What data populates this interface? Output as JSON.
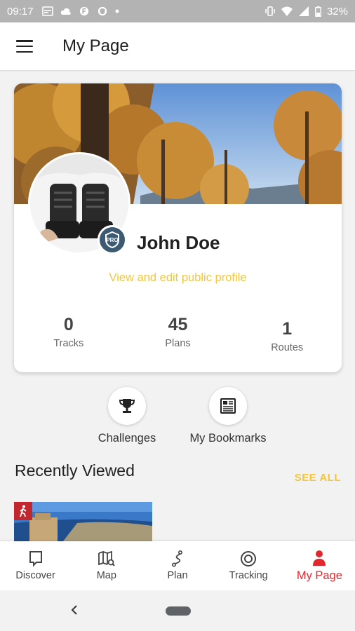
{
  "status_bar": {
    "time": "09:17",
    "battery": "32%",
    "icons": [
      "calendar-icon",
      "cloud-icon",
      "app-icon",
      "shield-icon",
      "dot-icon",
      "vibrate-icon",
      "wifi-icon",
      "signal-icon",
      "battery-icon"
    ]
  },
  "app_bar": {
    "title": "My Page",
    "menu_icon": "hamburger-icon"
  },
  "profile": {
    "name": "John Doe",
    "edit_link": "View and edit public profile",
    "badge": "PRO",
    "stats": [
      {
        "value": "0",
        "label": "Tracks"
      },
      {
        "value": "45",
        "label": "Plans"
      },
      {
        "value": "1",
        "label": "Routes"
      }
    ]
  },
  "shortcuts": [
    {
      "label": "Challenges",
      "icon": "trophy-icon"
    },
    {
      "label": "My Bookmarks",
      "icon": "bookmarks-icon"
    }
  ],
  "recently_viewed": {
    "title": "Recently Viewed",
    "see_all": "SEE ALL",
    "item_icon": "hiker-icon"
  },
  "bottom_nav": {
    "items": [
      {
        "label": "Discover",
        "icon": "discover-icon"
      },
      {
        "label": "Map",
        "icon": "map-icon"
      },
      {
        "label": "Plan",
        "icon": "plan-icon"
      },
      {
        "label": "Tracking",
        "icon": "tracking-icon"
      },
      {
        "label": "My Page",
        "icon": "person-icon"
      }
    ],
    "active_index": 4
  },
  "colors": {
    "accent": "#e0282e",
    "link": "#f2c53d",
    "badge": "#3d5a73",
    "status_bar": "#b3b3b3"
  }
}
